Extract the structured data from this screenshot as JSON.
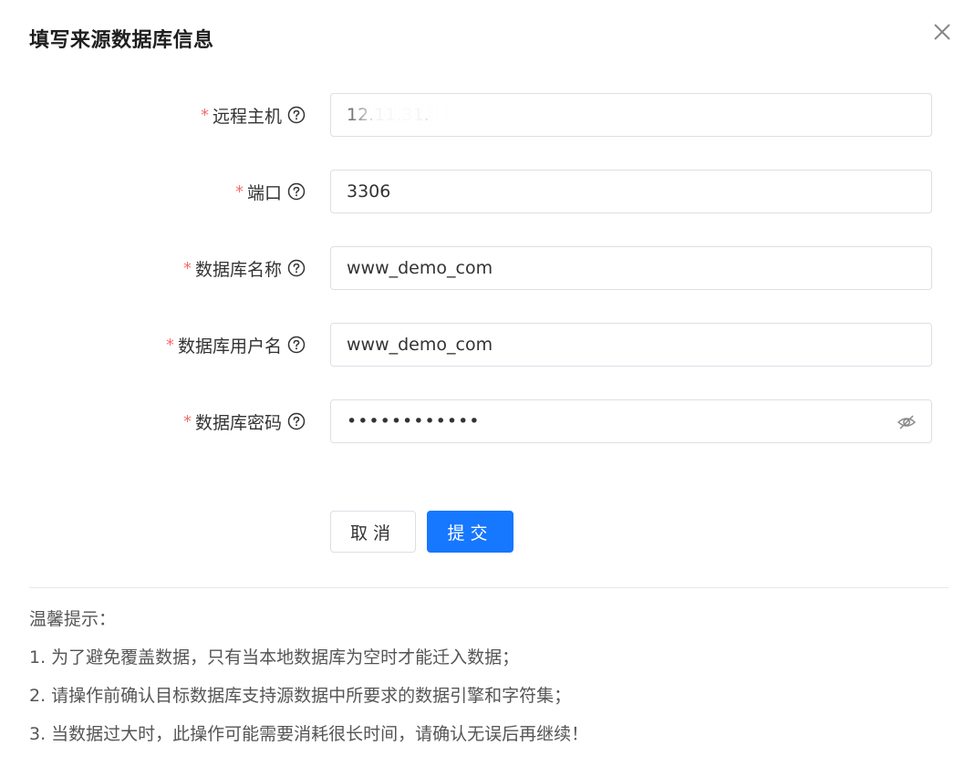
{
  "dialog": {
    "title": "填写来源数据库信息",
    "close_icon": "close-icon"
  },
  "form": {
    "required_mark": "*",
    "fields": [
      {
        "label": "远程主机",
        "value": "12.11.31.",
        "type": "text"
      },
      {
        "label": "端口",
        "value": "3306",
        "type": "text"
      },
      {
        "label": "数据库名称",
        "value": "www_demo_com",
        "type": "text"
      },
      {
        "label": "数据库用户名",
        "value": "www_demo_com",
        "type": "text"
      },
      {
        "label": "数据库密码",
        "value": "••••••••••••",
        "type": "password"
      }
    ],
    "help_icon": "question-circle-icon",
    "password_toggle_icon": "eye-off-icon"
  },
  "buttons": {
    "cancel": "取消",
    "submit": "提交"
  },
  "tips": {
    "title": "温馨提示：",
    "items": [
      "1. 为了避免覆盖数据，只有当本地数据库为空时才能迁入数据；",
      "2. 请操作前确认目标数据库支持源数据中所要求的数据引擎和字符集；",
      "3. 当数据过大时，此操作可能需要消耗很长时间，请确认无误后再继续！"
    ]
  },
  "colors": {
    "primary": "#1677ff",
    "required": "#f56c6c",
    "border": "#dcdfe6"
  }
}
